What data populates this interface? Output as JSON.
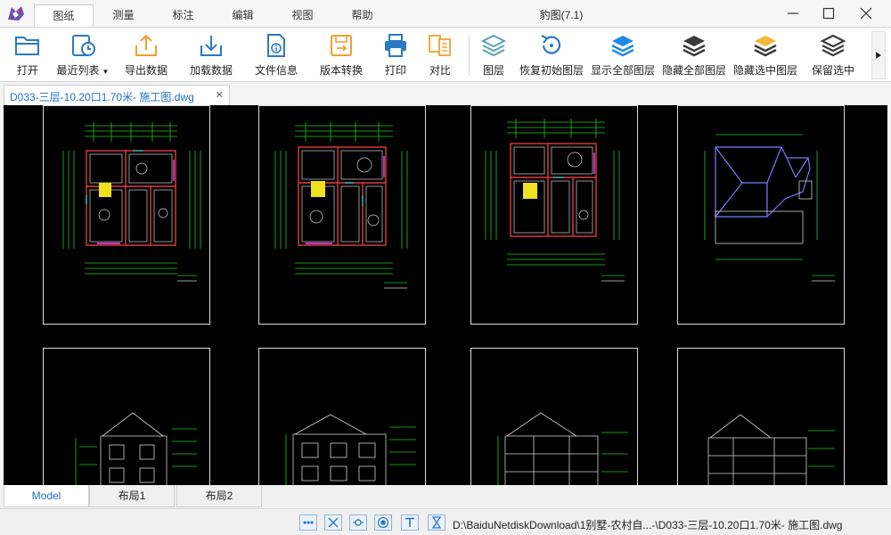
{
  "app": {
    "title": "豹图(7.1)",
    "accent": "#1b6fc6"
  },
  "menu": {
    "tabs": [
      "图纸",
      "测量",
      "标注",
      "编辑",
      "视图",
      "帮助"
    ],
    "active_tab": "图纸"
  },
  "toolbar": {
    "buttons": [
      {
        "label": "打开",
        "icon": "folder-open-icon"
      },
      {
        "label": "最近列表",
        "icon": "recent-clock-icon",
        "has_dropdown": true
      },
      {
        "label": "导出数据",
        "icon": "export-upload-icon"
      },
      {
        "label": "加载数据",
        "icon": "import-download-icon"
      },
      {
        "label": "文件信息",
        "icon": "file-info-icon"
      },
      {
        "label": "版本转换",
        "icon": "version-convert-icon"
      },
      {
        "label": "打印",
        "icon": "printer-icon"
      },
      {
        "label": "对比",
        "icon": "compare-icon"
      },
      {
        "label": "图层",
        "icon": "layers-icon"
      },
      {
        "label": "恢复初始图层",
        "icon": "restore-layers-icon"
      },
      {
        "label": "显示全部图层",
        "icon": "show-all-layers-icon"
      },
      {
        "label": "隐藏全部图层",
        "icon": "hide-all-layers-icon"
      },
      {
        "label": "隐藏选中图层",
        "icon": "hide-selected-layers-icon"
      },
      {
        "label": "保留选中",
        "icon": "keep-selected-icon"
      }
    ]
  },
  "document": {
    "tab_label": "D033-三层-10.20口1.70米- 施工图.dwg",
    "close_glyph": "✕"
  },
  "layouts": {
    "tabs": [
      "Model",
      "布局1",
      "布局2"
    ],
    "active": "Model"
  },
  "status": {
    "path": "D:\\BaiduNetdiskDownload\\1别墅-农村自...-\\D033-三层-10.20口1.70米- 施工图.dwg",
    "buttons": [
      "ortho-icon",
      "snap-cross-icon",
      "grid-node-icon",
      "target-icon",
      "text-icon",
      "hourglass-icon"
    ]
  }
}
